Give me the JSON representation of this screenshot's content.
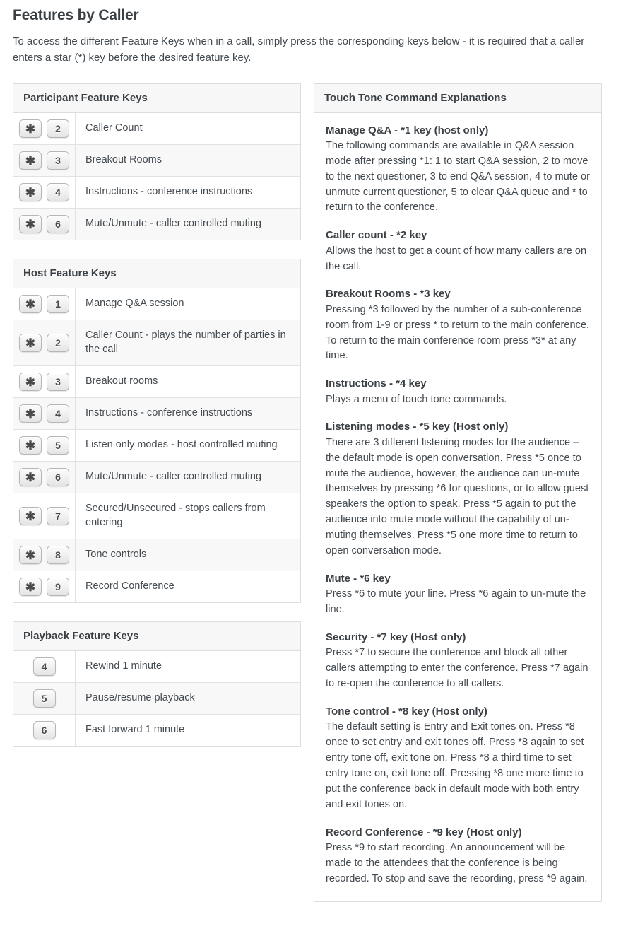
{
  "page": {
    "title": "Features by Caller",
    "intro": "To access the different Feature Keys when in a call, simply press the corresponding keys below - it is required that a caller enters a star (*) key before the desired feature key."
  },
  "colors": {
    "text": "#434a50",
    "heading": "#3b4045",
    "panel_border": "#dddddd",
    "row_border": "#e2e2e2",
    "header_bg": "#f7f7f7",
    "alt_row_bg": "#f8f8f8",
    "keycap_border": "#b6b6b6"
  },
  "tables": [
    {
      "id": "participant-feature-keys",
      "header": "Participant Feature Keys",
      "rows": [
        {
          "keys": [
            "*",
            "2"
          ],
          "label": "Caller Count"
        },
        {
          "keys": [
            "*",
            "3"
          ],
          "label": "Breakout Rooms"
        },
        {
          "keys": [
            "*",
            "4"
          ],
          "label": "Instructions - conference instructions"
        },
        {
          "keys": [
            "*",
            "6"
          ],
          "label": "Mute/Unmute - caller controlled muting"
        }
      ]
    },
    {
      "id": "host-feature-keys",
      "header": "Host Feature Keys",
      "rows": [
        {
          "keys": [
            "*",
            "1"
          ],
          "label": "Manage Q&A session"
        },
        {
          "keys": [
            "*",
            "2"
          ],
          "label": "Caller Count - plays the number of parties in the call"
        },
        {
          "keys": [
            "*",
            "3"
          ],
          "label": "Breakout rooms"
        },
        {
          "keys": [
            "*",
            "4"
          ],
          "label": "Instructions - conference instructions"
        },
        {
          "keys": [
            "*",
            "5"
          ],
          "label": "Listen only modes - host controlled muting"
        },
        {
          "keys": [
            "*",
            "6"
          ],
          "label": "Mute/Unmute - caller controlled muting"
        },
        {
          "keys": [
            "*",
            "7"
          ],
          "label": "Secured/Unsecured - stops callers from entering"
        },
        {
          "keys": [
            "*",
            "8"
          ],
          "label": "Tone controls"
        },
        {
          "keys": [
            "*",
            "9"
          ],
          "label": "Record Conference"
        }
      ]
    },
    {
      "id": "playback-feature-keys",
      "header": "Playback Feature Keys",
      "rows": [
        {
          "keys": [
            "4"
          ],
          "label": "Rewind 1 minute"
        },
        {
          "keys": [
            "5"
          ],
          "label": "Pause/resume playback"
        },
        {
          "keys": [
            "6"
          ],
          "label": "Fast forward 1 minute"
        }
      ]
    }
  ],
  "explanations": {
    "header": "Touch Tone Command Explanations",
    "blocks": [
      {
        "title": "Manage Q&A - *1 key (host only)",
        "text": "The following commands are available in Q&A session mode after pressing *1: 1 to start Q&A session, 2 to move to the next questioner, 3 to end Q&A session, 4 to mute or unmute current questioner, 5 to clear Q&A queue and * to return to the conference."
      },
      {
        "title": "Caller count - *2 key",
        "text": "Allows the host to get a count of how many callers are on the call."
      },
      {
        "title": "Breakout Rooms - *3 key",
        "text": "Pressing *3 followed by the number of a sub-conference room from 1-9 or press * to return to the main conference. To return to the main conference room press *3* at any time."
      },
      {
        "title": "Instructions - *4 key",
        "text": "Plays a menu of touch tone commands."
      },
      {
        "title": "Listening modes - *5 key (Host only)",
        "text": "There are 3 different listening modes for the audience – the default mode is open conversation. Press *5 once to mute the audience, however, the audience can un-mute themselves by pressing *6 for questions, or to allow guest speakers the option to speak. Press *5 again to put the audience into mute mode without the capability of un-muting themselves. Press *5 one more time to return to open conversation mode."
      },
      {
        "title": "Mute - *6 key",
        "text": "Press *6 to mute your line. Press *6 again to un-mute the line."
      },
      {
        "title": "Security - *7 key (Host only)",
        "text": "Press *7 to secure the conference and block all other callers attempting to enter the conference. Press *7 again to re-open the conference to all callers."
      },
      {
        "title": "Tone control - *8 key (Host only)",
        "text": "The default setting is Entry and Exit tones on. Press *8 once to set entry and exit tones off. Press *8 again to set entry tone off, exit tone on. Press *8 a third time to set entry tone on, exit tone off. Pressing *8 one more time to put the conference back in default mode with both entry and exit tones on."
      },
      {
        "title": "Record Conference - *9 key (Host only)",
        "text": "Press *9 to start recording. An announcement will be made to the attendees that the conference is being recorded. To stop and save the recording, press *9 again."
      }
    ]
  }
}
